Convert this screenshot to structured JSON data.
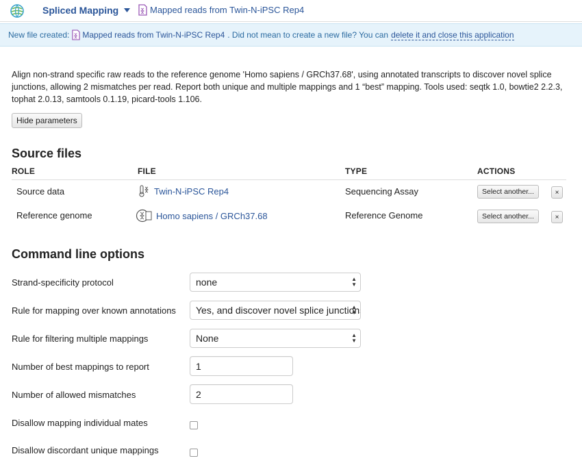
{
  "header": {
    "app_title": "Spliced Mapping",
    "file_name": "Mapped reads from Twin-N-iPSC Rep4",
    "logo_icon": "globe-logo-icon"
  },
  "notice": {
    "prefix": "New file created:",
    "file_name": "Mapped reads from Twin-N-iPSC Rep4",
    "message": ". Did not mean to create a new file? You can",
    "action_link": "delete it and close this application"
  },
  "description": "Align non-strand specific raw reads to the reference genome 'Homo sapiens / GRCh37.68', using annotated transcripts to discover novel splice junctions, allowing 2 mismatches per read. Report both unique and multiple mappings and 1 “best” mapping. Tools used: seqtk 1.0, bowtie2 2.2.3, tophat 2.0.13, samtools 0.1.19, picard-tools 1.106.",
  "hide_parameters_label": "Hide parameters",
  "source_files": {
    "title": "Source files",
    "columns": [
      "ROLE",
      "FILE",
      "TYPE",
      "ACTIONS"
    ],
    "rows": [
      {
        "role": "Source data",
        "file": "Twin-N-iPSC Rep4",
        "type": "Sequencing Assay",
        "action": "Select another...",
        "remove": "×",
        "icon": "sequencing-assay-icon"
      },
      {
        "role": "Reference genome",
        "file": "Homo sapiens / GRCh37.68",
        "type": "Reference Genome",
        "action": "Select another...",
        "remove": "×",
        "icon": "reference-genome-icon"
      }
    ]
  },
  "command_line": {
    "title": "Command line options",
    "options": [
      {
        "label": "Strand-specificity protocol",
        "kind": "select",
        "value": "none"
      },
      {
        "label": "Rule for mapping over known annotations",
        "kind": "select",
        "value": "Yes, and discover novel splice junctions"
      },
      {
        "label": "Rule for filtering multiple mappings",
        "kind": "select",
        "value": "None"
      },
      {
        "label": "Number of best mappings to report",
        "kind": "input",
        "value": "1"
      },
      {
        "label": "Number of allowed mismatches",
        "kind": "input",
        "value": "2"
      },
      {
        "label": "Disallow mapping individual mates",
        "kind": "checkbox",
        "checked": false
      },
      {
        "label": "Disallow discordant unique mappings",
        "kind": "checkbox",
        "checked": false
      }
    ]
  },
  "colors": {
    "link": "#2a5599",
    "notice_bg": "#e6f3fb",
    "file_icon": "#9b59b6"
  }
}
